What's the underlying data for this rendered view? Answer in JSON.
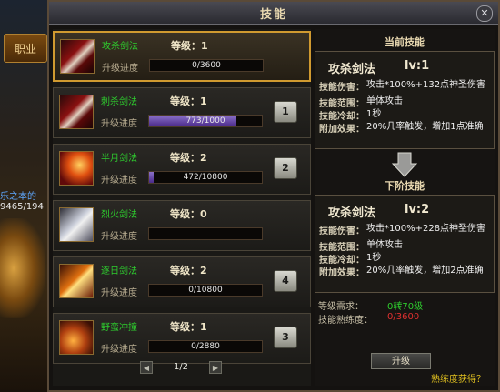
{
  "window": {
    "title": "技能"
  },
  "side_tab": {
    "label": "职业"
  },
  "character": {
    "name": "乐之本的",
    "hp": "9465/194"
  },
  "skills": [
    {
      "name": "攻杀剑法",
      "level": "等级：1",
      "progress_label": "升级进度",
      "progress_text": "0/3600",
      "progress": 0.0,
      "hotkey": ""
    },
    {
      "name": "刺杀剑法",
      "level": "等级：1",
      "progress_label": "升级进度",
      "progress_text": "773/1000",
      "progress": 0.773,
      "hotkey": "1"
    },
    {
      "name": "半月剑法",
      "level": "等级：2",
      "progress_label": "升级进度",
      "progress_text": "472/10800",
      "progress": 0.044,
      "hotkey": "2"
    },
    {
      "name": "烈火剑法",
      "level": "等级：0",
      "progress_label": "升级进度",
      "progress_text": "",
      "progress": 0.0,
      "hotkey": ""
    },
    {
      "name": "逐日剑法",
      "level": "等级：2",
      "progress_label": "升级进度",
      "progress_text": "0/10800",
      "progress": 0.0,
      "hotkey": "4"
    },
    {
      "name": "野蛮冲撞",
      "level": "等级：1",
      "progress_label": "升级进度",
      "progress_text": "0/2880",
      "progress": 0.0,
      "hotkey": "3"
    }
  ],
  "pager": {
    "text": "1/2"
  },
  "current": {
    "header": "当前技能",
    "name": "攻杀剑法",
    "level": "lv:1",
    "rows": [
      {
        "label": "技能伤害：",
        "value": "攻击*100%+132点神圣伤害"
      },
      {
        "label": "技能范围：",
        "value": "单体攻击"
      },
      {
        "label": "技能冷却：",
        "value": "1秒"
      },
      {
        "label": "附加效果：",
        "value": "20%几率触发，增加1点准确"
      }
    ]
  },
  "next": {
    "header": "下阶技能",
    "name": "攻杀剑法",
    "level": "lv:2",
    "rows": [
      {
        "label": "技能伤害：",
        "value": "攻击*100%+228点神圣伤害"
      },
      {
        "label": "技能范围：",
        "value": "单体攻击"
      },
      {
        "label": "技能冷却：",
        "value": "1秒"
      },
      {
        "label": "附加效果：",
        "value": "20%几率触发，增加2点准确"
      }
    ]
  },
  "requirements": {
    "level_label": "等级需求：",
    "level_value": "0转70级",
    "skill_label": "技能熟练度：",
    "skill_value": "0/3600"
  },
  "upgrade_button": "升级",
  "help_link": "熟练度获得？",
  "colors": {
    "skill_name": "#2ecc2e",
    "req_green": "#2ecc2e",
    "req_red": "#e03030",
    "selected_border": "#d09a30",
    "help": "#e0c020"
  }
}
